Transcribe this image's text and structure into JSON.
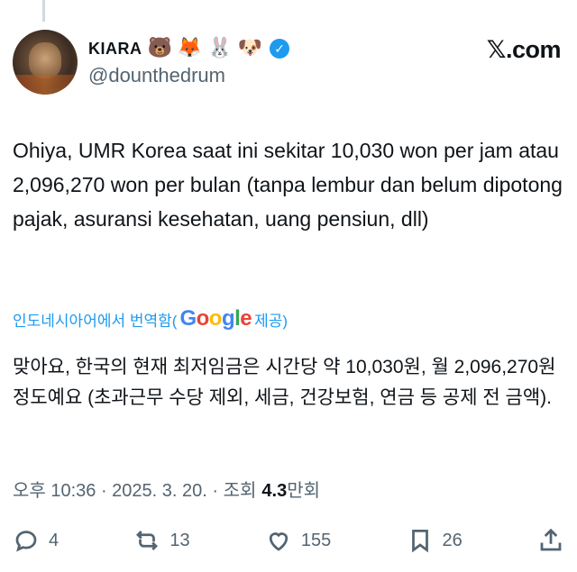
{
  "tweet": {
    "display_name": "KIARA",
    "emojis": [
      "🐻",
      "🦊",
      "🐰",
      "🐶"
    ],
    "verified_icon": "check-badge-icon",
    "handle": "@dounthedrum",
    "brand": "𝕏.com",
    "text": "Ohiya, UMR Korea saat ini sekitar 10,030 won per jam atau 2,096,270 won per bulan (tanpa lembur dan belum dipotong pajak, asuransi kesehatan, uang pensiun, dll)",
    "translation_label": "인도네시아어에서 번역함(",
    "translation_suffix": " 제공)",
    "translated_text": "맞아요, 한국의 현재 최저임금은 시간당 약 10,030원, 월 2,096,270원 정도예요 (초과근무 수당 제외, 세금, 건강보험, 연금 등 공제 전 금액).",
    "timestamp": "오후 10:36 · 2025. 3. 20. · 조회 ",
    "views": "4.3",
    "views_unit": "만회"
  },
  "actions": {
    "reply_count": "4",
    "retweet_count": "13",
    "like_count": "155",
    "bookmark_count": "26"
  },
  "colors": {
    "accent": "#1d9bf0",
    "muted": "#536471",
    "text": "#0f1419"
  }
}
